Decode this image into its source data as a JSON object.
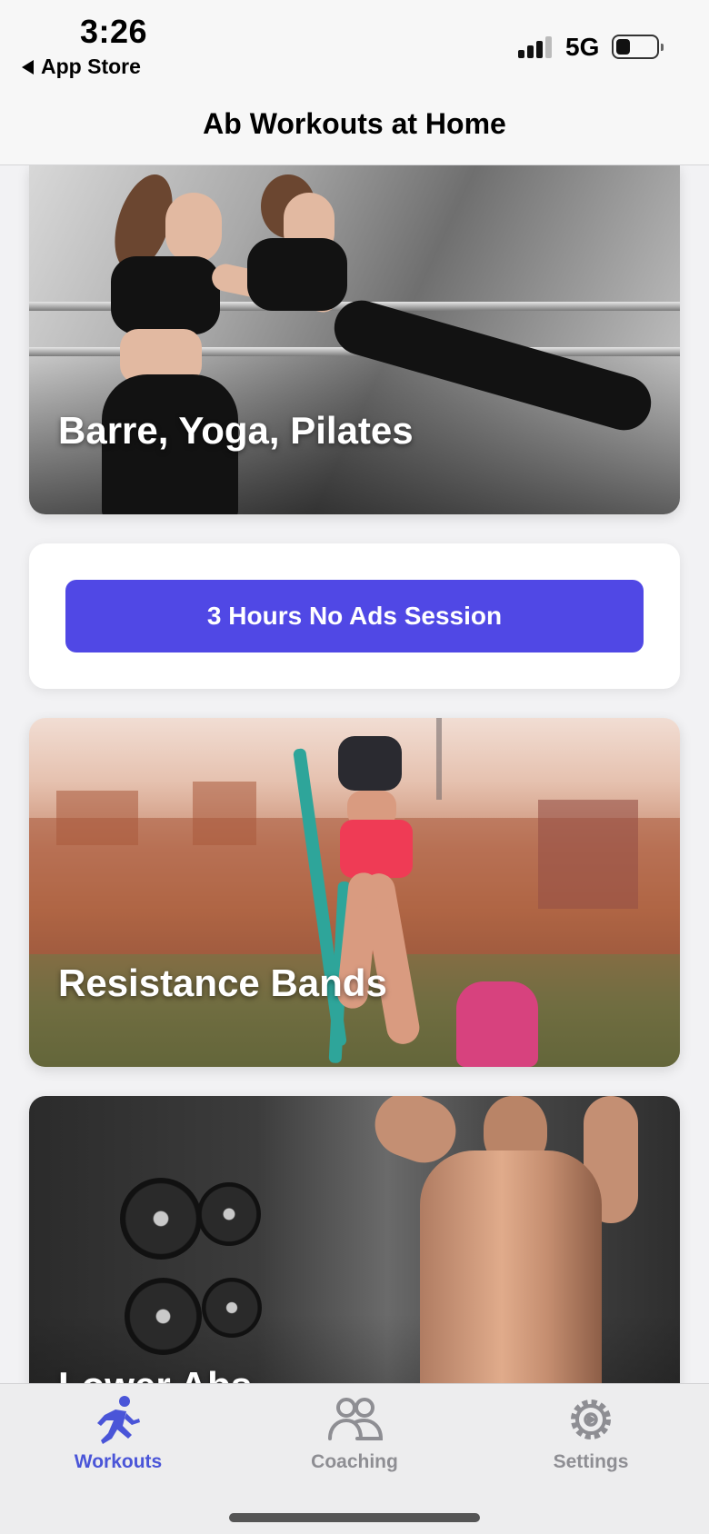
{
  "status_bar": {
    "time": "3:26",
    "back_label": "App Store",
    "network": "5G",
    "battery_level": 0.35
  },
  "nav": {
    "title": "Ab Workouts at Home"
  },
  "cards": [
    {
      "label": "Barre, Yoga, Pilates"
    },
    {
      "label": "Resistance Bands"
    },
    {
      "label": "Lower Abs"
    }
  ],
  "ad": {
    "button_label": "3 Hours No Ads Session",
    "accent_color": "#5048e5"
  },
  "tabs": [
    {
      "label": "Workouts",
      "icon": "running-person-icon",
      "active": true
    },
    {
      "label": "Coaching",
      "icon": "people-icon",
      "active": false
    },
    {
      "label": "Settings",
      "icon": "gear-icon",
      "active": false
    }
  ],
  "colors": {
    "tab_active": "#4a55d8",
    "tab_inactive": "#8e8e93"
  }
}
